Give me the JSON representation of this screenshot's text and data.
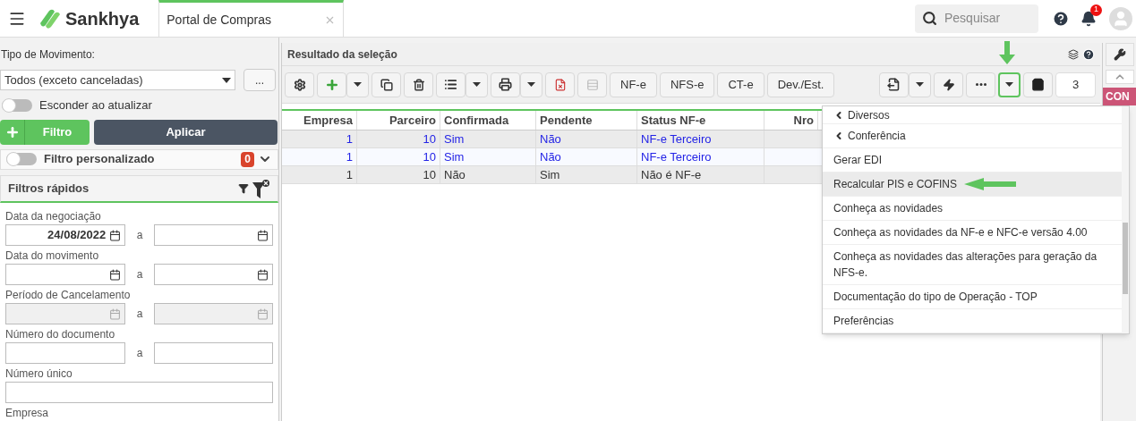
{
  "header": {
    "brand": "Sankhya",
    "tab": {
      "label": "Portal de Compras",
      "selected": true
    },
    "search": {
      "placeholder": "Pesquisar"
    },
    "notifications": "1"
  },
  "left": {
    "movement_label": "Tipo de Movimento:",
    "movement_value": "Todos (exceto canceladas)",
    "more": "...",
    "hide_toggle": {
      "label": "Esconder ao atualizar",
      "on": false
    },
    "filter_button": "Filtro",
    "apply_button": "Aplicar",
    "custom_filter": {
      "label": "Filtro personalizado",
      "on": false,
      "count": "0"
    },
    "quick_filters": {
      "title": "Filtros rápidos",
      "fields": [
        {
          "label": "Data da negociação",
          "kind": "date_range",
          "disabled": false,
          "from": "24/08/2022",
          "to_label": "a"
        },
        {
          "label": "Data do movimento",
          "kind": "date_range",
          "disabled": false,
          "to_label": "a"
        },
        {
          "label": "Período de Cancelamento",
          "kind": "date_range",
          "disabled": true,
          "to_label": "a"
        },
        {
          "label": "Número do documento",
          "kind": "text_range",
          "disabled": false,
          "to_label": "a"
        },
        {
          "label": "Número único",
          "kind": "text",
          "disabled": false
        },
        {
          "label": "Empresa",
          "kind": "label_only"
        }
      ]
    }
  },
  "main": {
    "title": "Resultado da seleção",
    "toolbar": {
      "text_buttons": [
        "NF-e",
        "NFS-e",
        "CT-e",
        "Dev./Est."
      ],
      "page": "3"
    },
    "table": {
      "columns": [
        "Empresa",
        "Parceiro",
        "Confirmada",
        "Pendente",
        "Status NF-e",
        "Nro"
      ],
      "rows": [
        {
          "cells": [
            "1",
            "10",
            "Sim",
            "Não",
            "NF-e Terceiro"
          ],
          "emphasis": true
        },
        {
          "cells": [
            "1",
            "10",
            "Sim",
            "Não",
            "NF-e Terceiro"
          ],
          "emphasis": true
        },
        {
          "cells": [
            "1",
            "10",
            "Não",
            "Sim",
            "Não é NF-e"
          ],
          "emphasis": false
        }
      ]
    }
  },
  "menu": {
    "items": [
      {
        "label": "Diversos",
        "kind": "submenu",
        "selected": false
      },
      {
        "label": "Conferência",
        "kind": "submenu",
        "selected": false
      },
      {
        "label": "Gerar EDI",
        "kind": "action",
        "selected": false
      },
      {
        "label": "Recalcular PIS e COFINS",
        "kind": "action",
        "selected": true
      },
      {
        "label": "Conheça as novidades",
        "kind": "action",
        "selected": false
      },
      {
        "label": "Conheça as novidades da NF-e e NFC-e versão 4.00",
        "kind": "action",
        "selected": false
      },
      {
        "label": "Conheça as novidades das alterações para geração da NFS-e.",
        "kind": "action",
        "selected": false
      },
      {
        "label": "Documentação do tipo de Operação - TOP",
        "kind": "action",
        "selected": false
      },
      {
        "label": "Preferências",
        "kind": "action",
        "selected": false
      }
    ]
  },
  "side": {
    "badge": "CON"
  }
}
